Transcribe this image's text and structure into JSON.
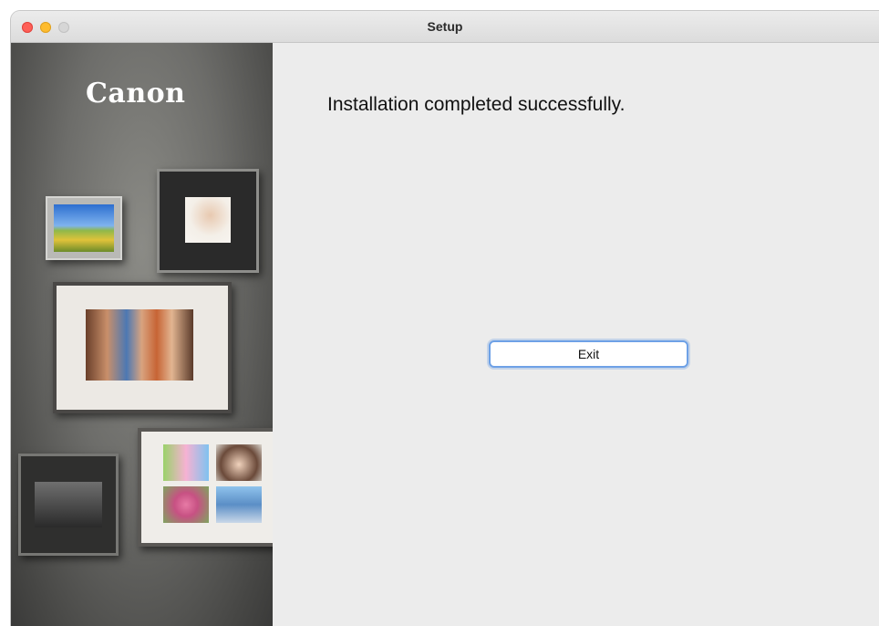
{
  "window": {
    "title": "Setup"
  },
  "sidebar": {
    "logo_text": "Canon"
  },
  "main": {
    "message": "Installation completed successfully.",
    "exit_label": "Exit"
  },
  "colors": {
    "close": "#fe5f57",
    "minimize": "#febc2e",
    "zoom_disabled": "#d6d6d6",
    "button_focus": "#6ea1e6"
  }
}
